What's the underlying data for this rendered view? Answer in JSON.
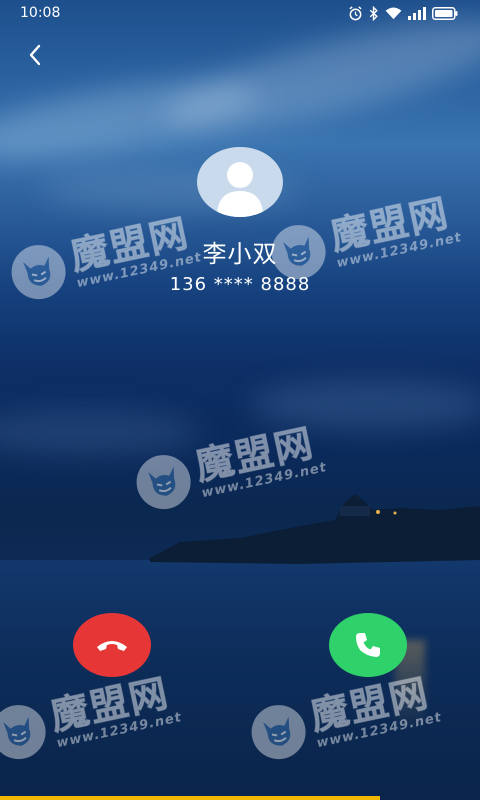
{
  "status_bar": {
    "time": "10:08",
    "icons": [
      "alarm-icon",
      "bluetooth-icon",
      "wifi-icon",
      "signal-icon",
      "battery-icon"
    ]
  },
  "navigation": {
    "back_icon": "chevron-left-icon"
  },
  "caller": {
    "name": "李小双",
    "number": "136 **** 8888",
    "avatar_icon": "person-silhouette-icon"
  },
  "actions": {
    "decline": {
      "icon": "phone-hangup-icon",
      "color": "#e63636"
    },
    "answer": {
      "icon": "phone-icon",
      "color": "#2fd26a"
    }
  },
  "watermark": {
    "title": "魔盟网",
    "url": "www.12349.net",
    "logo_icon": "devil-face-icon"
  },
  "theme": {
    "text_color": "#ffffff",
    "accent_bar": "#f2b705"
  }
}
